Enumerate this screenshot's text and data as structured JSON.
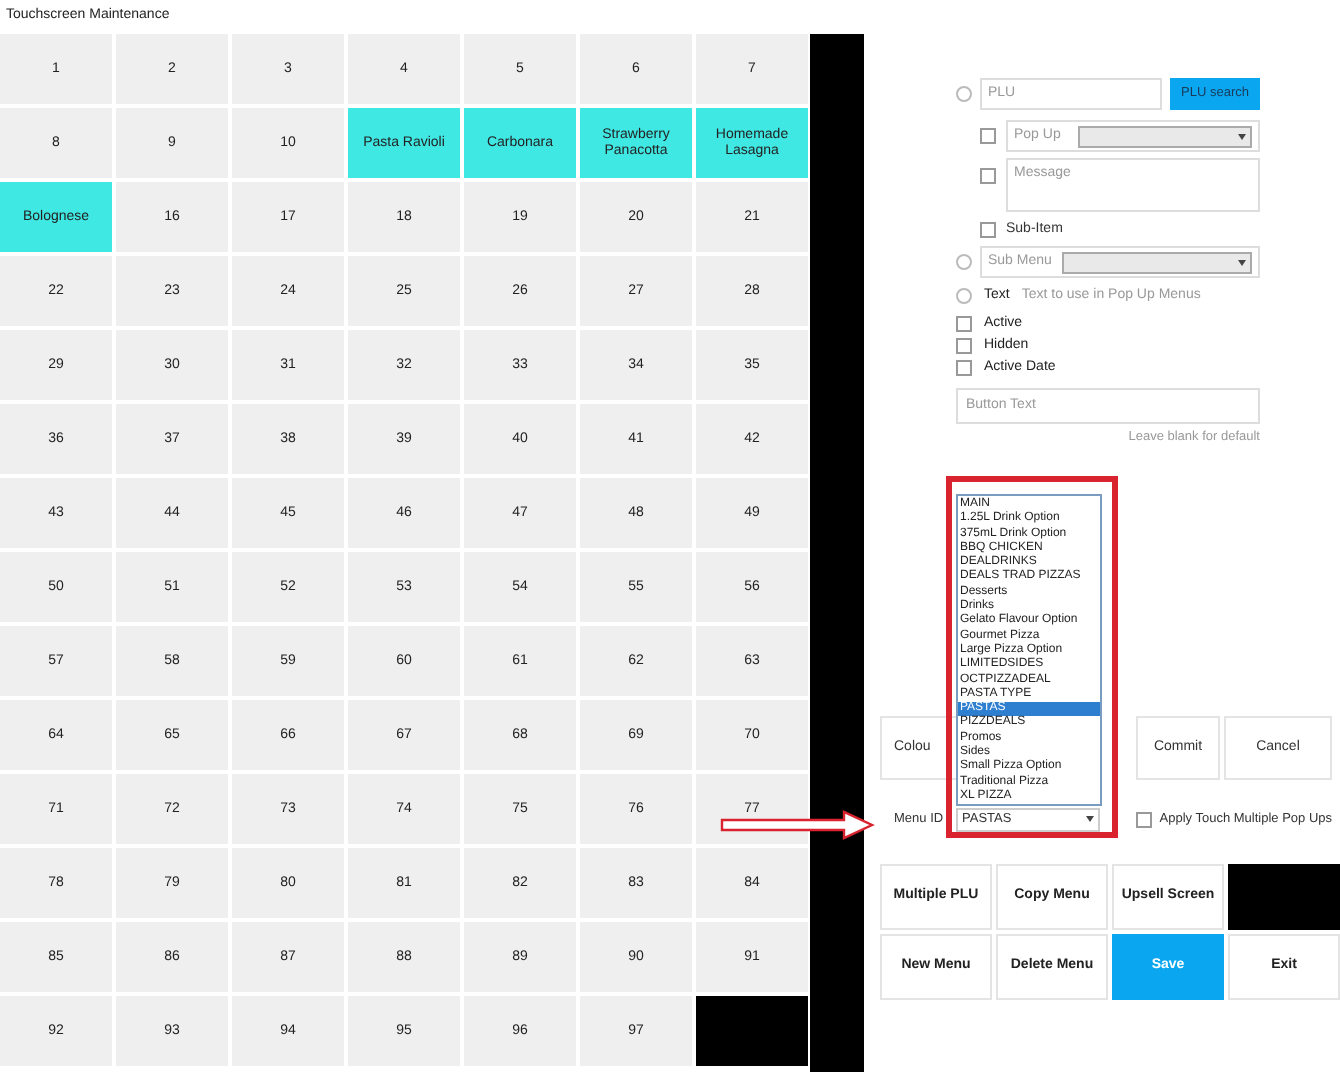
{
  "window": {
    "title": "Touchscreen Maintenance"
  },
  "grid": {
    "cells": [
      {
        "label": "1",
        "highlighted": false
      },
      {
        "label": "2",
        "highlighted": false
      },
      {
        "label": "3",
        "highlighted": false
      },
      {
        "label": "4",
        "highlighted": false
      },
      {
        "label": "5",
        "highlighted": false
      },
      {
        "label": "6",
        "highlighted": false
      },
      {
        "label": "7",
        "highlighted": false
      },
      {
        "label": "8",
        "highlighted": false
      },
      {
        "label": "9",
        "highlighted": false
      },
      {
        "label": "10",
        "highlighted": false
      },
      {
        "label": "Pasta Ravioli",
        "highlighted": true
      },
      {
        "label": "Carbonara",
        "highlighted": true
      },
      {
        "label": "Strawberry Panacotta",
        "highlighted": true
      },
      {
        "label": "Homemade Lasagna",
        "highlighted": true
      },
      {
        "label": "Bolognese",
        "highlighted": true
      },
      {
        "label": "16",
        "highlighted": false
      },
      {
        "label": "17",
        "highlighted": false
      },
      {
        "label": "18",
        "highlighted": false
      },
      {
        "label": "19",
        "highlighted": false
      },
      {
        "label": "20",
        "highlighted": false
      },
      {
        "label": "21",
        "highlighted": false
      },
      {
        "label": "22",
        "highlighted": false
      },
      {
        "label": "23",
        "highlighted": false
      },
      {
        "label": "24",
        "highlighted": false
      },
      {
        "label": "25",
        "highlighted": false
      },
      {
        "label": "26",
        "highlighted": false
      },
      {
        "label": "27",
        "highlighted": false
      },
      {
        "label": "28",
        "highlighted": false
      },
      {
        "label": "29",
        "highlighted": false
      },
      {
        "label": "30",
        "highlighted": false
      },
      {
        "label": "31",
        "highlighted": false
      },
      {
        "label": "32",
        "highlighted": false
      },
      {
        "label": "33",
        "highlighted": false
      },
      {
        "label": "34",
        "highlighted": false
      },
      {
        "label": "35",
        "highlighted": false
      },
      {
        "label": "36",
        "highlighted": false
      },
      {
        "label": "37",
        "highlighted": false
      },
      {
        "label": "38",
        "highlighted": false
      },
      {
        "label": "39",
        "highlighted": false
      },
      {
        "label": "40",
        "highlighted": false
      },
      {
        "label": "41",
        "highlighted": false
      },
      {
        "label": "42",
        "highlighted": false
      },
      {
        "label": "43",
        "highlighted": false
      },
      {
        "label": "44",
        "highlighted": false
      },
      {
        "label": "45",
        "highlighted": false
      },
      {
        "label": "46",
        "highlighted": false
      },
      {
        "label": "47",
        "highlighted": false
      },
      {
        "label": "48",
        "highlighted": false
      },
      {
        "label": "49",
        "highlighted": false
      },
      {
        "label": "50",
        "highlighted": false
      },
      {
        "label": "51",
        "highlighted": false
      },
      {
        "label": "52",
        "highlighted": false
      },
      {
        "label": "53",
        "highlighted": false
      },
      {
        "label": "54",
        "highlighted": false
      },
      {
        "label": "55",
        "highlighted": false
      },
      {
        "label": "56",
        "highlighted": false
      },
      {
        "label": "57",
        "highlighted": false
      },
      {
        "label": "58",
        "highlighted": false
      },
      {
        "label": "59",
        "highlighted": false
      },
      {
        "label": "60",
        "highlighted": false
      },
      {
        "label": "61",
        "highlighted": false
      },
      {
        "label": "62",
        "highlighted": false
      },
      {
        "label": "63",
        "highlighted": false
      },
      {
        "label": "64",
        "highlighted": false
      },
      {
        "label": "65",
        "highlighted": false
      },
      {
        "label": "66",
        "highlighted": false
      },
      {
        "label": "67",
        "highlighted": false
      },
      {
        "label": "68",
        "highlighted": false
      },
      {
        "label": "69",
        "highlighted": false
      },
      {
        "label": "70",
        "highlighted": false
      },
      {
        "label": "71",
        "highlighted": false
      },
      {
        "label": "72",
        "highlighted": false
      },
      {
        "label": "73",
        "highlighted": false
      },
      {
        "label": "74",
        "highlighted": false
      },
      {
        "label": "75",
        "highlighted": false
      },
      {
        "label": "76",
        "highlighted": false
      },
      {
        "label": "77",
        "highlighted": false
      },
      {
        "label": "78",
        "highlighted": false
      },
      {
        "label": "79",
        "highlighted": false
      },
      {
        "label": "80",
        "highlighted": false
      },
      {
        "label": "81",
        "highlighted": false
      },
      {
        "label": "82",
        "highlighted": false
      },
      {
        "label": "83",
        "highlighted": false
      },
      {
        "label": "84",
        "highlighted": false
      },
      {
        "label": "85",
        "highlighted": false
      },
      {
        "label": "86",
        "highlighted": false
      },
      {
        "label": "87",
        "highlighted": false
      },
      {
        "label": "88",
        "highlighted": false
      },
      {
        "label": "89",
        "highlighted": false
      },
      {
        "label": "90",
        "highlighted": false
      },
      {
        "label": "91",
        "highlighted": false
      },
      {
        "label": "92",
        "highlighted": false
      },
      {
        "label": "93",
        "highlighted": false
      },
      {
        "label": "94",
        "highlighted": false
      },
      {
        "label": "95",
        "highlighted": false
      },
      {
        "label": "96",
        "highlighted": false
      },
      {
        "label": "97",
        "highlighted": false
      }
    ]
  },
  "form": {
    "plu": {
      "selected": false,
      "placeholder": "PLU",
      "button": "PLU search"
    },
    "pop_up": {
      "checked": false,
      "placeholder": "Pop Up"
    },
    "message": {
      "checked": false,
      "placeholder": "Message"
    },
    "sub_item": {
      "checked": false,
      "label": "Sub-Item"
    },
    "sub_menu": {
      "selected": false,
      "placeholder": "Sub Menu"
    },
    "text_option": {
      "selected": false,
      "label": "Text",
      "hint": "Text to use in Pop Up Menus"
    },
    "flags": [
      {
        "label": "Active",
        "checked": false
      },
      {
        "label": "Hidden",
        "checked": false
      },
      {
        "label": "Active Date",
        "checked": false
      }
    ],
    "button_text": {
      "placeholder": "Button Text",
      "hint": "Leave blank for default"
    }
  },
  "action_buttons": [
    {
      "label": "Colou"
    },
    {
      "label": "Commit"
    },
    {
      "label": "Cancel"
    }
  ],
  "menu_id": {
    "label": "Menu ID",
    "value": "PASTAS",
    "options": [
      {
        "label": "MAIN",
        "selected": false
      },
      {
        "label": "1.25L Drink Option",
        "selected": false
      },
      {
        "label": "375mL Drink Option",
        "selected": false
      },
      {
        "label": "BBQ CHICKEN",
        "selected": false
      },
      {
        "label": "DEALDRINKS",
        "selected": false
      },
      {
        "label": "DEALS TRAD PIZZAS",
        "selected": false
      },
      {
        "label": "Desserts",
        "selected": false
      },
      {
        "label": "Drinks",
        "selected": false
      },
      {
        "label": "Gelato Flavour Option",
        "selected": false
      },
      {
        "label": "Gourmet Pizza",
        "selected": false
      },
      {
        "label": "Large Pizza Option",
        "selected": false
      },
      {
        "label": "LIMITEDSIDES",
        "selected": false
      },
      {
        "label": "OCTPIZZADEAL",
        "selected": false
      },
      {
        "label": "PASTA TYPE",
        "selected": false
      },
      {
        "label": "PASTAS",
        "selected": true
      },
      {
        "label": "PIZZDEALS",
        "selected": false
      },
      {
        "label": "Promos",
        "selected": false
      },
      {
        "label": "Sides",
        "selected": false
      },
      {
        "label": "Small Pizza Option",
        "selected": false
      },
      {
        "label": "Traditional Pizza",
        "selected": false
      },
      {
        "label": "XL PIZZA",
        "selected": false
      }
    ]
  },
  "apply_multiple": {
    "label": "Apply Touch Multiple Pop Ups",
    "checked": false
  },
  "bottom_buttons": [
    {
      "kind": "plain",
      "label": "Multiple PLU"
    },
    {
      "kind": "plain",
      "label": "Copy Menu"
    },
    {
      "kind": "plain",
      "label": "Upsell Screen"
    },
    {
      "kind": "swatch"
    },
    {
      "kind": "plain",
      "label": "New Menu"
    },
    {
      "kind": "plain",
      "label": "Delete Menu"
    },
    {
      "kind": "primary",
      "label": "Save"
    },
    {
      "kind": "plain",
      "label": "Exit"
    }
  ]
}
